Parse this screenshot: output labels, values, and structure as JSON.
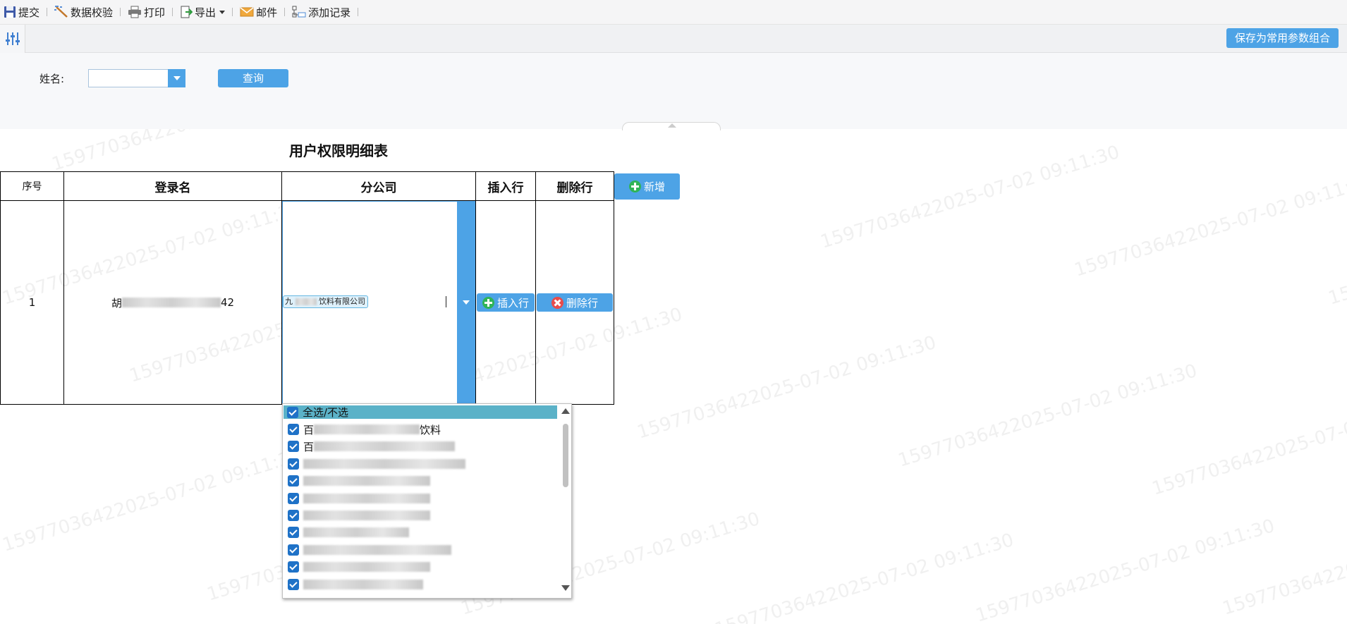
{
  "toolbar": {
    "submit": "提交",
    "validate": "数据校验",
    "print": "打印",
    "export": "导出",
    "mail": "邮件",
    "add_record": "添加记录"
  },
  "params": {
    "save_combo": "保存为常用参数组合",
    "name_label": "姓名:",
    "name_value": "",
    "query": "查询"
  },
  "report": {
    "title": "用户权限明细表",
    "headers": {
      "seq": "序号",
      "login": "登录名",
      "branch": "分公司",
      "insert": "插入行",
      "delete": "删除行"
    },
    "add_button": "新增",
    "row": {
      "seq": "1",
      "login_prefix": "胡",
      "login_suffix": "42",
      "branch_chip_prefix": "九",
      "branch_chip_suffix": "饮料有限公司",
      "insert_button": "插入行",
      "delete_button": "删除行"
    }
  },
  "dropdown": {
    "select_all": "全选/不选",
    "items": [
      {
        "prefix": "百",
        "suffix": "饮料",
        "checked": true
      },
      {
        "prefix": "百",
        "suffix": "",
        "checked": true
      },
      {
        "prefix": "",
        "suffix": "",
        "checked": true
      },
      {
        "prefix": "",
        "suffix": "",
        "checked": true
      },
      {
        "prefix": "",
        "suffix": "",
        "checked": true
      },
      {
        "prefix": "",
        "suffix": "",
        "checked": true
      },
      {
        "prefix": "",
        "suffix": "",
        "checked": true
      },
      {
        "prefix": "",
        "suffix": "",
        "checked": true
      },
      {
        "prefix": "",
        "suffix": "",
        "checked": true
      },
      {
        "prefix": "",
        "suffix": "",
        "checked": true
      }
    ]
  },
  "watermark": "15977036422025-07-02 09:11:30",
  "colors": {
    "accent": "#4da3e6",
    "select_all_bg": "#5bb2c8",
    "checkbox": "#1f72c7",
    "add_green": "#2fb457",
    "delete_red": "#e84c4c"
  }
}
